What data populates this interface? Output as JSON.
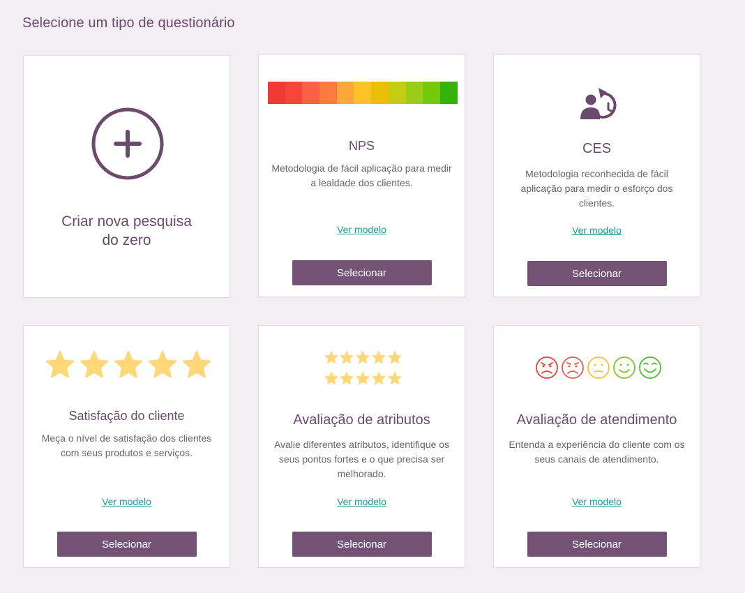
{
  "page": {
    "title": "Selecione um tipo de questionário"
  },
  "new_card": {
    "label_line1": "Criar nova pesquisa",
    "label_line2": "do zero"
  },
  "common": {
    "view_label": "Ver modelo",
    "select_label": "Selecionar"
  },
  "colors": {
    "accent": "#745276",
    "link": "#1a9a8e",
    "nps_scale": [
      "#ef3a35",
      "#f5453b",
      "#f76148",
      "#fb7c3d",
      "#fda63a",
      "#fec229",
      "#e8c00a",
      "#c2cc13",
      "#9acd17",
      "#74c90a",
      "#34b30a"
    ],
    "star": "#fed778",
    "faces": [
      "#e93c34",
      "#ea5b4b",
      "#f1c431",
      "#7bc62c",
      "#4dbc28"
    ]
  },
  "cards": [
    {
      "title": "NPS",
      "description": "Metodologia de fácil aplicação para medir a lealdade dos clientes.",
      "icon": "nps-scale-icon"
    },
    {
      "title": "CES",
      "description": "Metodologia reconhecida de fácil aplicação para medir o esforço dos clientes.",
      "icon": "user-refresh-icon"
    },
    {
      "title": "Satisfação do cliente",
      "description": "Meça o nível de satisfação dos clientes com seus produtos e serviços.",
      "icon": "five-stars-icon"
    },
    {
      "title": "Avaliação de atributos",
      "description": "Avalie diferentes atributos, identifique os seus pontos fortes e o que precisa ser melhorado.",
      "icon": "star-grid-icon"
    },
    {
      "title": "Avaliação de atendimento",
      "description": "Entenda a experiência do cliente com os seus canais de atendimento.",
      "icon": "emoji-faces-icon"
    }
  ]
}
